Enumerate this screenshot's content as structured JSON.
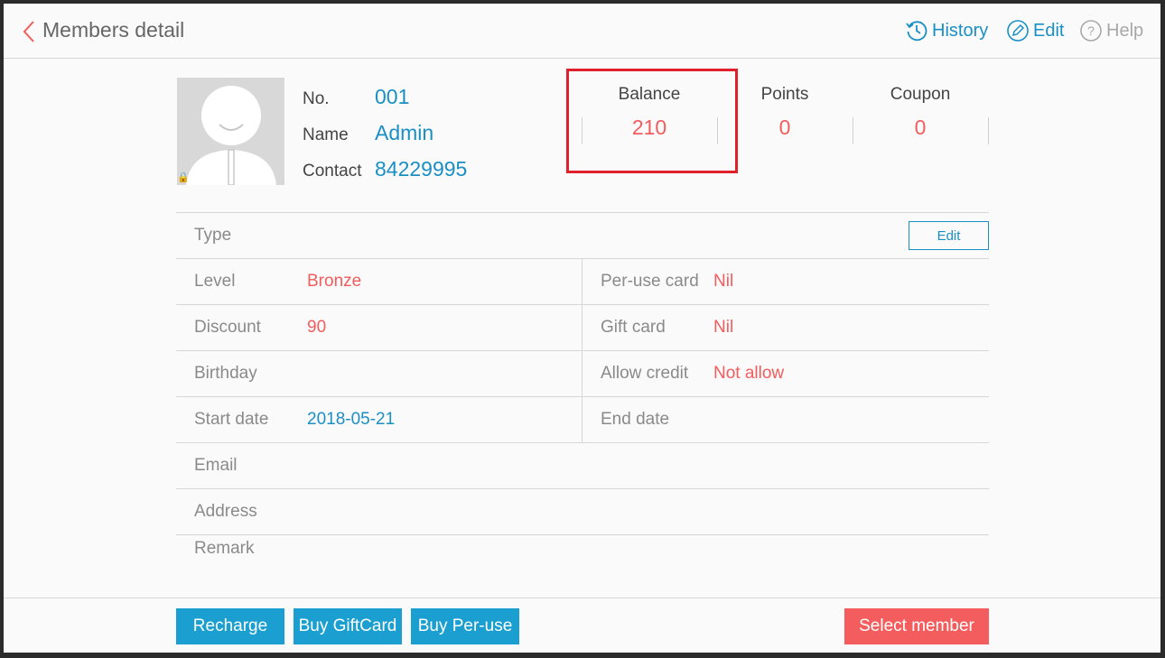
{
  "header": {
    "title": "Members detail",
    "history_label": "History",
    "edit_label": "Edit",
    "help_label": "Help"
  },
  "member": {
    "no_label": "No.",
    "no_value": "001",
    "name_label": "Name",
    "name_value": "Admin",
    "contact_label": "Contact",
    "contact_value": "84229995"
  },
  "stats": {
    "balance_label": "Balance",
    "balance_value": "210",
    "points_label": "Points",
    "points_value": "0",
    "coupon_label": "Coupon",
    "coupon_value": "0"
  },
  "details": {
    "type_label": "Type",
    "type_edit_label": "Edit",
    "level_label": "Level",
    "level_value": "Bronze",
    "peruse_label": "Per-use card",
    "peruse_value": "Nil",
    "discount_label": "Discount",
    "discount_value": "90",
    "giftcard_label": "Gift card",
    "giftcard_value": "Nil",
    "birthday_label": "Birthday",
    "birthday_value": "",
    "credit_label": "Allow credit",
    "credit_value": "Not allow",
    "start_label": "Start date",
    "start_value": "2018-05-21",
    "end_label": "End date",
    "end_value": "",
    "email_label": "Email",
    "address_label": "Address",
    "remark_label": "Remark"
  },
  "footer": {
    "recharge_label": "Recharge",
    "buy_giftcard_label": "Buy GiftCard",
    "buy_peruse_label": "Buy Per-use",
    "select_member_label": "Select member"
  },
  "colors": {
    "accent_blue": "#1a8fc4",
    "accent_red": "#f25c5c",
    "highlight_red": "#e0202a"
  }
}
